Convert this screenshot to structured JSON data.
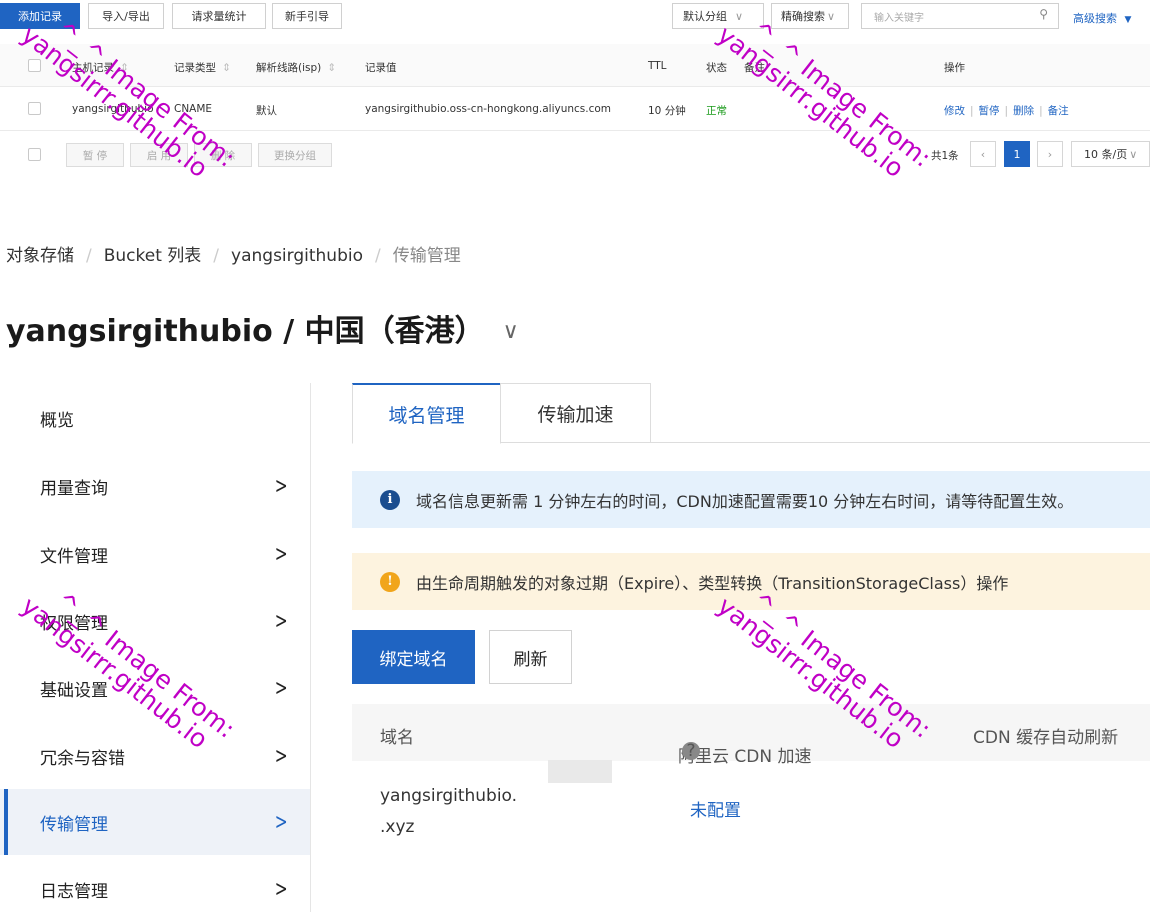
{
  "dns": {
    "toolbar": {
      "add_record": "添加记录",
      "import_export": "导入/导出",
      "request_stats": "请求量统计",
      "guide": "新手引导",
      "group_select": "默认分组",
      "search_mode": "精确搜索",
      "search_placeholder": "输入关键字",
      "advanced_search": "高级搜索"
    },
    "columns": {
      "host": "主机记录",
      "type": "记录类型",
      "line": "解析线路(isp)",
      "value": "记录值",
      "ttl": "TTL",
      "status": "状态",
      "remark": "备注",
      "actions": "操作"
    },
    "row": {
      "host": "yangsirgithubio",
      "type": "CNAME",
      "line": "默认",
      "value": "yangsirgithubio.oss-cn-hongkong.aliyuncs.com",
      "ttl": "10 分钟",
      "status": "正常",
      "actions": [
        "修改",
        "暂停",
        "删除",
        "备注"
      ]
    },
    "bulk": [
      "暂 停",
      "启 用",
      "删 除",
      "更换分组"
    ],
    "pager": {
      "total": "共1条",
      "page": "1",
      "page_size": "10 条/页"
    }
  },
  "oss": {
    "breadcrumb": [
      "对象存储",
      "Bucket 列表",
      "yangsirgithubio",
      "传输管理"
    ],
    "title": "yangsirgithubio / 中国（香港）",
    "sidebar": [
      {
        "label": "概览",
        "arrow": false,
        "active": false
      },
      {
        "label": "用量查询",
        "arrow": true,
        "active": false
      },
      {
        "label": "文件管理",
        "arrow": true,
        "active": false
      },
      {
        "label": "权限管理",
        "arrow": true,
        "active": false
      },
      {
        "label": "基础设置",
        "arrow": true,
        "active": false
      },
      {
        "label": "冗余与容错",
        "arrow": true,
        "active": false
      },
      {
        "label": "传输管理",
        "arrow": true,
        "active": true
      },
      {
        "label": "日志管理",
        "arrow": true,
        "active": false
      }
    ],
    "tabs": [
      "域名管理",
      "传输加速"
    ],
    "info_banner": "域名信息更新需 1 分钟左右的时间，CDN加速配置需要10 分钟左右时间，请等待配置生效。",
    "warn_banner": "由生命周期触发的对象过期（Expire）、类型转换（TransitionStorageClass）操作",
    "buttons": {
      "bind": "绑定域名",
      "refresh": "刷新"
    },
    "table": {
      "headers": [
        "域名",
        "阿里云 CDN 加速",
        "CDN 缓存自动刷新"
      ],
      "rows": [
        {
          "domain_line1": "yangsirgithubio.",
          "domain_line2": ".xyz",
          "cdn": "未配置"
        }
      ]
    }
  },
  "watermark": {
    "line1": "^_^ Image From:",
    "line2": "yangsirrr.github.io"
  },
  "colors": {
    "accent": "#1f64c2",
    "watermark": "#c000c6",
    "info_bg": "#e5f1fc",
    "warn_bg": "#fdf3df"
  }
}
